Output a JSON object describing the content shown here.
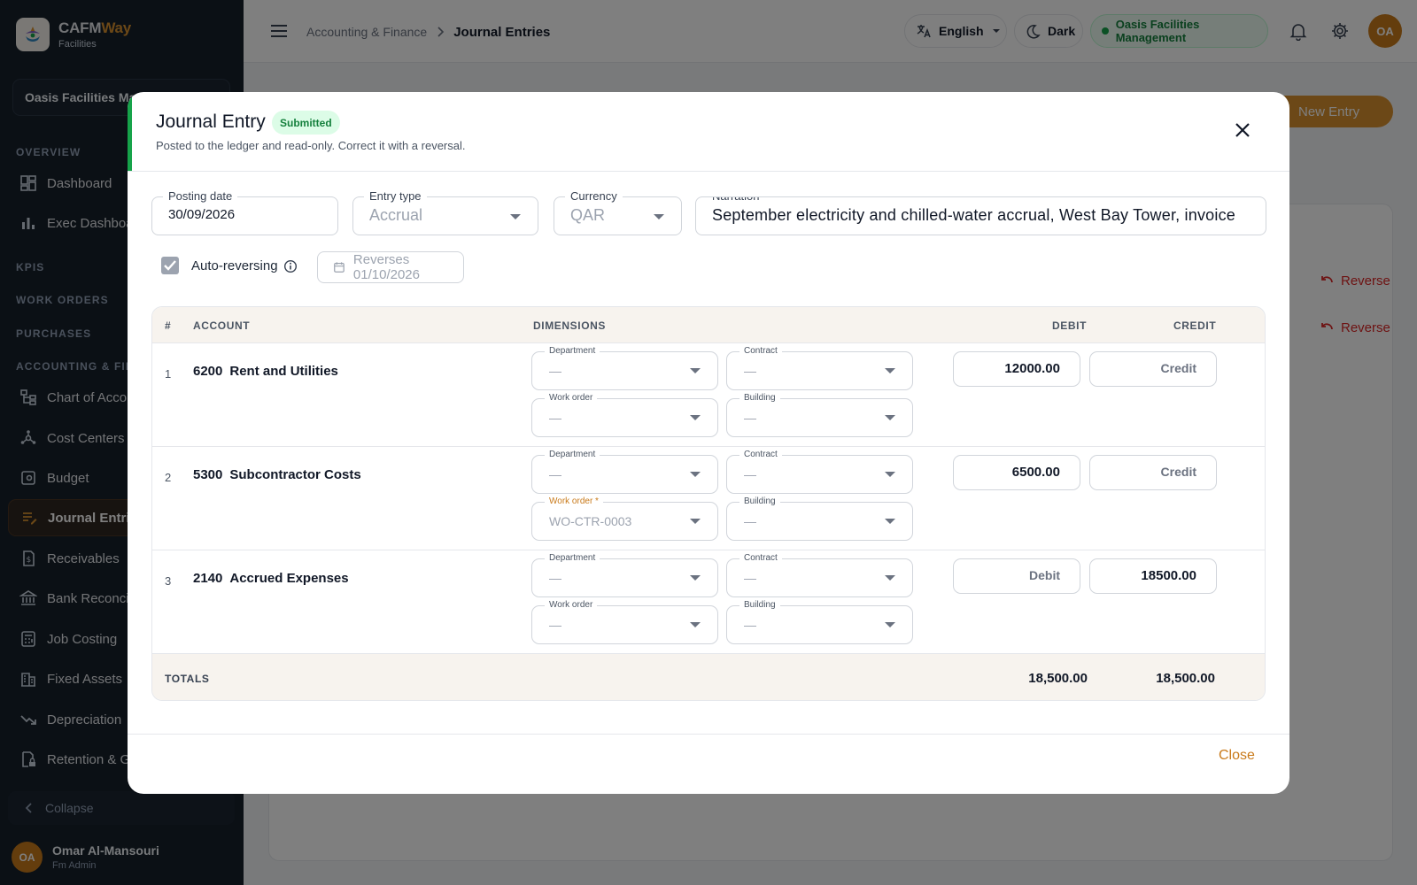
{
  "brand": {
    "name_a": "CAFM",
    "name_b": "Way",
    "sub": "Facilities"
  },
  "sidebar": {
    "org": "Oasis Facilities Management",
    "sections": {
      "overview": "OVERVIEW",
      "kpis": "KPIS",
      "work_orders": "WORK ORDERS",
      "purchases": "PURCHASES",
      "accounting": "ACCOUNTING & FINANCE"
    },
    "items": [
      {
        "label": "Dashboard",
        "icon": "dashboard-icon"
      },
      {
        "label": "Exec Dashboard",
        "icon": "bar-chart-icon"
      },
      {
        "label": "Chart of Accounts",
        "icon": "account-tree-icon"
      },
      {
        "label": "Cost Centers",
        "icon": "hub-icon"
      },
      {
        "label": "Budget",
        "icon": "budget-icon"
      },
      {
        "label": "Journal Entries",
        "icon": "journal-icon",
        "active": true
      },
      {
        "label": "Receivables",
        "icon": "receipt-icon"
      },
      {
        "label": "Bank Reconciliation",
        "icon": "bank-icon"
      },
      {
        "label": "Job Costing",
        "icon": "calculator-icon"
      },
      {
        "label": "Fixed Assets",
        "icon": "building-icon"
      },
      {
        "label": "Depreciation",
        "icon": "trend-down-icon"
      },
      {
        "label": "Retention & Guarantees",
        "icon": "lock-doc-icon"
      }
    ],
    "collapse": "Collapse",
    "user": {
      "initials": "OA",
      "name": "Omar Al-Mansouri",
      "role": "Fm Admin"
    }
  },
  "header": {
    "breadcrumb_parent": "Accounting & Finance",
    "breadcrumb_current": "Journal Entries",
    "language": "English",
    "theme": "Dark",
    "org": "Oasis Facilities Management",
    "avatar": "OA"
  },
  "page": {
    "new_entry": "New Entry",
    "reverse": "Reverse"
  },
  "modal": {
    "title": "Journal Entry",
    "status": "Submitted",
    "subtitle": "Posted to the ledger and read-only. Correct it with a reversal.",
    "posting_date_label": "Posting date",
    "posting_date": "30/09/2026",
    "entry_type_label": "Entry type",
    "entry_type": "Accrual",
    "currency_label": "Currency",
    "currency": "QAR",
    "narration_label": "Narration",
    "narration": "September electricity and chilled-water accrual, West Bay Tower, invoice",
    "auto_reversing_label": "Auto-reversing",
    "auto_reversing": true,
    "reverses": "Reverses 01/10/2026",
    "columns": {
      "num": "#",
      "account": "ACCOUNT",
      "dimensions": "DIMENSIONS",
      "debit": "DEBIT",
      "credit": "CREDIT"
    },
    "dim_labels": {
      "department": "Department",
      "contract": "Contract",
      "work_order": "Work order",
      "work_order_req": "Work order *",
      "building": "Building"
    },
    "empty": "—",
    "debit_ph": "Debit",
    "credit_ph": "Credit",
    "lines": [
      {
        "n": "1",
        "code": "6200",
        "name": "Rent and Utilities",
        "department": "—",
        "contract": "—",
        "work_order": "—",
        "building": "—",
        "debit": "12000.00",
        "credit": ""
      },
      {
        "n": "2",
        "code": "5300",
        "name": "Subcontractor Costs",
        "department": "—",
        "contract": "—",
        "work_order": "WO-CTR-0003",
        "building": "—",
        "debit": "6500.00",
        "credit": ""
      },
      {
        "n": "3",
        "code": "2140",
        "name": "Accrued Expenses",
        "department": "—",
        "contract": "—",
        "work_order": "—",
        "building": "—",
        "debit": "",
        "credit": "18500.00"
      }
    ],
    "totals_label": "TOTALS",
    "total_debit": "18,500.00",
    "total_credit": "18,500.00",
    "close": "Close"
  },
  "colors": {
    "accent": "#d8912e",
    "success": "#16a34a",
    "danger": "#dc2626",
    "sidebar": "#16202b"
  }
}
